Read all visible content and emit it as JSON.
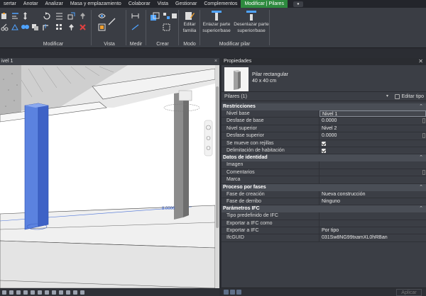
{
  "menu": {
    "tabs": [
      "sertar",
      "Anotar",
      "Analizar",
      "Masa y emplazamiento",
      "Colaborar",
      "Vista",
      "Gestionar",
      "Complementos",
      "Modificar | Pilares"
    ],
    "active_index": 8
  },
  "ribbon": {
    "groups": {
      "modificar": "Modificar",
      "vista": "Vista",
      "medir": "Medir",
      "crear": "Crear",
      "modo": "Modo",
      "modificar_pilar": "Modificar pilar"
    },
    "buttons": {
      "editar_familia": [
        "Editar",
        "familia"
      ],
      "enlazar": [
        "Enlazar parte",
        "superior/base"
      ],
      "desenlazar": [
        "Desenlazar parte",
        "superior/base"
      ]
    }
  },
  "view": {
    "tab_label": "ivel 1",
    "dimension": "8.0000"
  },
  "properties": {
    "title": "Propiedades",
    "type_name": "Pilar rectangular",
    "type_size": "40 x 40 cm",
    "selector": "Pilares (1)",
    "edit_type": "Editar tipo",
    "sections": [
      {
        "name": "Restricciones",
        "rows": [
          {
            "k": "Nivel base",
            "v": "Nivel 1",
            "boxed": true
          },
          {
            "k": "Desfase de base",
            "v": "0.0000",
            "spin": true
          },
          {
            "k": "Nivel superior",
            "v": "Nivel 2"
          },
          {
            "k": "Desfase superior",
            "v": "0.0000",
            "spin": true
          },
          {
            "k": "Se mueve con rejillas",
            "check": true
          },
          {
            "k": "Delimitación de habitación",
            "check": true
          }
        ]
      },
      {
        "name": "Datos de identidad",
        "rows": [
          {
            "k": "Imagen",
            "v": ""
          },
          {
            "k": "Comentarios",
            "v": "",
            "spin": true
          },
          {
            "k": "Marca",
            "v": ""
          }
        ]
      },
      {
        "name": "Proceso por fases",
        "rows": [
          {
            "k": "Fase de creación",
            "v": "Nueva construcción"
          },
          {
            "k": "Fase de derribo",
            "v": "Ninguno"
          }
        ]
      },
      {
        "name": "Parámetros IFC",
        "rows": [
          {
            "k": "Tipo predefinido de IFC",
            "v": ""
          },
          {
            "k": "Exportar a IFC como",
            "v": ""
          },
          {
            "k": "Exportar a IFC",
            "v": "Por tipo"
          },
          {
            "k": "IfcGUID",
            "v": "031Sw8NG99txamXL0hRBan"
          }
        ]
      }
    ],
    "apply_label": "Aplicar"
  },
  "colors": {
    "active_tab": "#2d8a3e",
    "selected_column": "#4a72d8",
    "panel_bg": "#3b3e45"
  }
}
